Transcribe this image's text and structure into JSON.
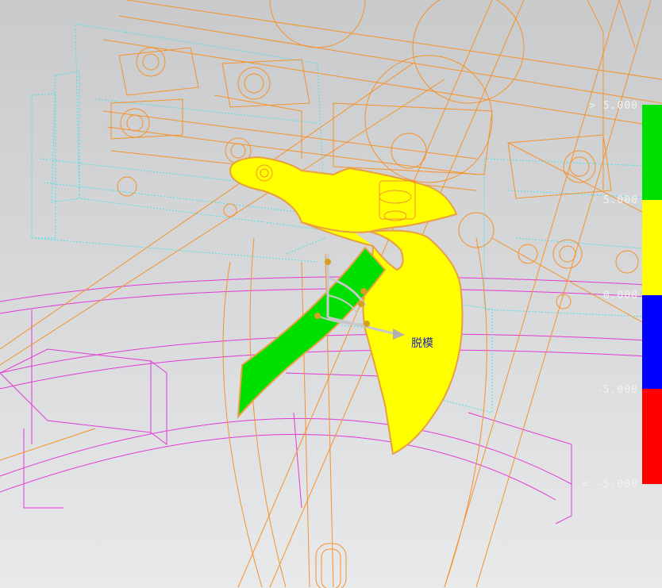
{
  "viewport": {
    "draft_direction_label": "脱模"
  },
  "legend": {
    "labels": [
      "> 5.000",
      "5.000",
      "0.000",
      "-5.000",
      "< -5.000"
    ],
    "bands": [
      {
        "name": "positive-above",
        "color": "#00e000"
      },
      {
        "name": "positive",
        "color": "#ffff00"
      },
      {
        "name": "negative",
        "color": "#0000ff"
      },
      {
        "name": "negative-below",
        "color": "#ff0000"
      }
    ]
  },
  "colors": {
    "wire_orange": "#f5922a",
    "wire_cyan": "#4de0e6",
    "wire_magenta": "#e23ad6",
    "face_yellow": "#ffff00",
    "face_green": "#00e000",
    "face_edge": "#e8a040",
    "axis_blue": "#1a2aa8"
  }
}
